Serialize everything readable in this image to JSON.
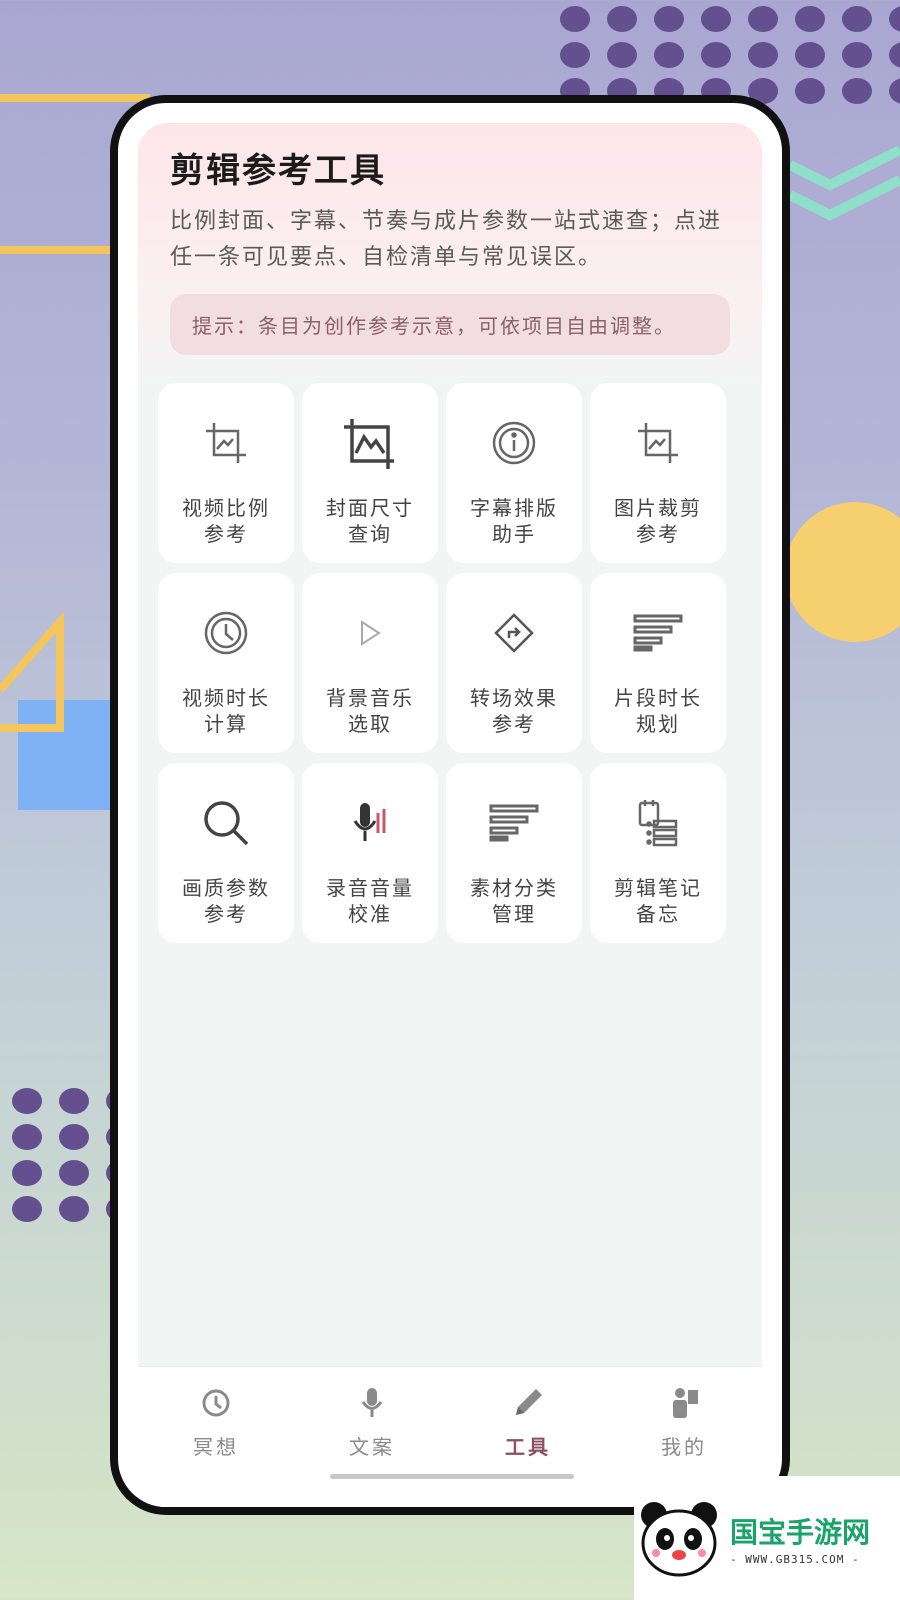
{
  "app": {
    "title": "剪辑参考工具",
    "description": "比例封面、字幕、节奏与成片参数一站式速查；点进任一条可见要点、自检清单与常见误区。",
    "tip": "提示：条目为创作参考示意，可依项目自由调整。"
  },
  "tools": [
    {
      "label": "视频比例参考",
      "icon": "crop-icon"
    },
    {
      "label": "封面尺寸查询",
      "icon": "image-crop-icon"
    },
    {
      "label": "字幕排版助手",
      "icon": "info-icon"
    },
    {
      "label": "图片裁剪参考",
      "icon": "crop-icon"
    },
    {
      "label": "视频时长计算",
      "icon": "clock-icon"
    },
    {
      "label": "背景音乐选取",
      "icon": "play-icon"
    },
    {
      "label": "转场效果参考",
      "icon": "direction-sign-icon"
    },
    {
      "label": "片段时长规划",
      "icon": "lines-icon"
    },
    {
      "label": "画质参数参考",
      "icon": "search-icon"
    },
    {
      "label": "录音音量校准",
      "icon": "microphone-icon"
    },
    {
      "label": "素材分类管理",
      "icon": "lines-icon"
    },
    {
      "label": "剪辑笔记备忘",
      "icon": "notes-list-icon"
    }
  ],
  "tabbar": {
    "items": [
      {
        "label": "冥想",
        "icon": "clock-icon",
        "active": false
      },
      {
        "label": "文案",
        "icon": "microphone-icon",
        "active": false
      },
      {
        "label": "工具",
        "icon": "pencil-icon",
        "active": true
      },
      {
        "label": "我的",
        "icon": "person-icon",
        "active": false
      }
    ]
  },
  "watermark": {
    "name": "国宝手游网",
    "url": "- WWW.GB315.COM -"
  },
  "colors": {
    "accent": "#8b4e63",
    "header_pink": "#fde6ea",
    "tip_bg": "#f2dde3",
    "dots": "#65508f",
    "watermark_green": "#1aa36b"
  }
}
